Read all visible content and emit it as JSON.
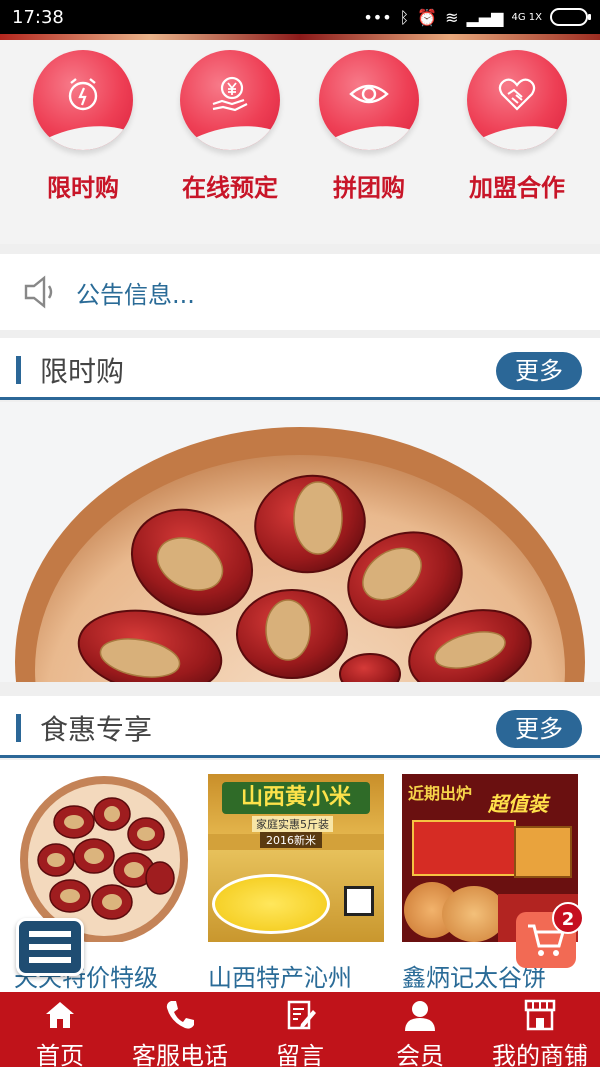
{
  "status_bar": {
    "time": "17:38",
    "signal_text": "4G 1X"
  },
  "quick_menu": [
    {
      "label": "限时购",
      "icon": "alarm-clock-icon"
    },
    {
      "label": "在线预定",
      "icon": "yen-hand-icon"
    },
    {
      "label": "拼团购",
      "icon": "eye-icon"
    },
    {
      "label": "加盟合作",
      "icon": "handshake-heart-icon"
    }
  ],
  "notice": {
    "text": "公告信息..."
  },
  "sections": {
    "flash_sale": {
      "title": "限时购",
      "more": "更多"
    },
    "food_deals": {
      "title": "食惠专享",
      "more": "更多"
    }
  },
  "products": [
    {
      "name": "天天特价特级"
    },
    {
      "name": "山西特产沁州",
      "image_text": {
        "title": "山西黄小米",
        "sub": "家庭实惠5斤装",
        "year": "2016新米"
      }
    },
    {
      "name": "鑫炳记太谷饼",
      "image_text": {
        "title": "近期出炉",
        "sub": "超值装"
      }
    }
  ],
  "cart": {
    "count": "2"
  },
  "tabbar": [
    {
      "label": "首页",
      "icon": "home-icon"
    },
    {
      "label": "客服电话",
      "icon": "phone-icon"
    },
    {
      "label": "留言",
      "icon": "edit-note-icon"
    },
    {
      "label": "会员",
      "icon": "user-icon"
    },
    {
      "label": "我的商铺",
      "icon": "shop-icon"
    }
  ],
  "colors": {
    "brand_red": "#c0131a",
    "accent_blue": "#2b6797",
    "pink": "#ee3f55"
  }
}
